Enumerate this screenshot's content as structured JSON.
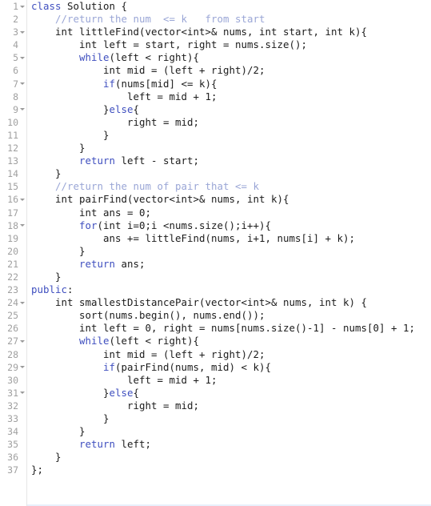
{
  "editor": {
    "language": "cpp",
    "background_color": "#ffffff",
    "gutter_color": "#ffffff",
    "line_number_color": "#a0a0a0",
    "keyword_color": "#3f4fbf",
    "comment_color": "#9aa6d6",
    "text_color": "#1b1b1b",
    "divider_color": "#e6e6e6",
    "total_lines": 37
  },
  "lines": [
    {
      "number": "1",
      "foldable": true,
      "tokens": [
        {
          "t": "kw",
          "s": "class"
        },
        {
          "t": "plain",
          "s": " Solution {"
        }
      ]
    },
    {
      "number": "2",
      "foldable": false,
      "tokens": [
        {
          "t": "plain",
          "s": "    "
        },
        {
          "t": "cmt",
          "s": "//return the num  <= k   from start"
        }
      ]
    },
    {
      "number": "3",
      "foldable": true,
      "tokens": [
        {
          "t": "plain",
          "s": "    "
        },
        {
          "t": "type",
          "s": "int"
        },
        {
          "t": "plain",
          "s": " littleFind("
        },
        {
          "t": "type",
          "s": "vector"
        },
        {
          "t": "punct",
          "s": "<"
        },
        {
          "t": "type",
          "s": "int"
        },
        {
          "t": "punct",
          "s": ">&"
        },
        {
          "t": "plain",
          "s": " nums, "
        },
        {
          "t": "type",
          "s": "int"
        },
        {
          "t": "plain",
          "s": " start, "
        },
        {
          "t": "type",
          "s": "int"
        },
        {
          "t": "plain",
          "s": " k){"
        }
      ]
    },
    {
      "number": "4",
      "foldable": false,
      "tokens": [
        {
          "t": "plain",
          "s": "        "
        },
        {
          "t": "type",
          "s": "int"
        },
        {
          "t": "plain",
          "s": " left = start, right = nums.size();"
        }
      ]
    },
    {
      "number": "5",
      "foldable": true,
      "tokens": [
        {
          "t": "plain",
          "s": "        "
        },
        {
          "t": "kw",
          "s": "while"
        },
        {
          "t": "plain",
          "s": "(left < right){"
        }
      ]
    },
    {
      "number": "6",
      "foldable": false,
      "tokens": [
        {
          "t": "plain",
          "s": "            "
        },
        {
          "t": "type",
          "s": "int"
        },
        {
          "t": "plain",
          "s": " mid = (left + right)/"
        },
        {
          "t": "num",
          "s": "2"
        },
        {
          "t": "plain",
          "s": ";"
        }
      ]
    },
    {
      "number": "7",
      "foldable": true,
      "tokens": [
        {
          "t": "plain",
          "s": "            "
        },
        {
          "t": "kw",
          "s": "if"
        },
        {
          "t": "plain",
          "s": "(nums[mid] <= k){"
        }
      ]
    },
    {
      "number": "8",
      "foldable": false,
      "tokens": [
        {
          "t": "plain",
          "s": "                left = mid + "
        },
        {
          "t": "num",
          "s": "1"
        },
        {
          "t": "plain",
          "s": ";"
        }
      ]
    },
    {
      "number": "9",
      "foldable": true,
      "tokens": [
        {
          "t": "plain",
          "s": "            }"
        },
        {
          "t": "kw",
          "s": "else"
        },
        {
          "t": "plain",
          "s": "{"
        }
      ]
    },
    {
      "number": "10",
      "foldable": false,
      "tokens": [
        {
          "t": "plain",
          "s": "                right = mid;"
        }
      ]
    },
    {
      "number": "11",
      "foldable": false,
      "tokens": [
        {
          "t": "plain",
          "s": "            }"
        }
      ]
    },
    {
      "number": "12",
      "foldable": false,
      "tokens": [
        {
          "t": "plain",
          "s": "        }"
        }
      ]
    },
    {
      "number": "13",
      "foldable": false,
      "tokens": [
        {
          "t": "plain",
          "s": "        "
        },
        {
          "t": "kw",
          "s": "return"
        },
        {
          "t": "plain",
          "s": " left - start;"
        }
      ]
    },
    {
      "number": "14",
      "foldable": false,
      "tokens": [
        {
          "t": "plain",
          "s": "    }"
        }
      ]
    },
    {
      "number": "15",
      "foldable": false,
      "tokens": [
        {
          "t": "plain",
          "s": "    "
        },
        {
          "t": "cmt",
          "s": "//return the num of pair that <= k"
        }
      ]
    },
    {
      "number": "16",
      "foldable": true,
      "tokens": [
        {
          "t": "plain",
          "s": "    "
        },
        {
          "t": "type",
          "s": "int"
        },
        {
          "t": "plain",
          "s": " pairFind("
        },
        {
          "t": "type",
          "s": "vector"
        },
        {
          "t": "punct",
          "s": "<"
        },
        {
          "t": "type",
          "s": "int"
        },
        {
          "t": "punct",
          "s": ">&"
        },
        {
          "t": "plain",
          "s": " nums, "
        },
        {
          "t": "type",
          "s": "int"
        },
        {
          "t": "plain",
          "s": " k){"
        }
      ]
    },
    {
      "number": "17",
      "foldable": false,
      "tokens": [
        {
          "t": "plain",
          "s": "        "
        },
        {
          "t": "type",
          "s": "int"
        },
        {
          "t": "plain",
          "s": " ans = "
        },
        {
          "t": "num",
          "s": "0"
        },
        {
          "t": "plain",
          "s": ";"
        }
      ]
    },
    {
      "number": "18",
      "foldable": true,
      "tokens": [
        {
          "t": "plain",
          "s": "        "
        },
        {
          "t": "kw",
          "s": "for"
        },
        {
          "t": "plain",
          "s": "("
        },
        {
          "t": "type",
          "s": "int"
        },
        {
          "t": "plain",
          "s": " i="
        },
        {
          "t": "num",
          "s": "0"
        },
        {
          "t": "plain",
          "s": ";i <nums.size();i++){"
        }
      ]
    },
    {
      "number": "19",
      "foldable": false,
      "tokens": [
        {
          "t": "plain",
          "s": "            ans += littleFind(nums, i+"
        },
        {
          "t": "num",
          "s": "1"
        },
        {
          "t": "plain",
          "s": ", nums[i] + k);"
        }
      ]
    },
    {
      "number": "20",
      "foldable": false,
      "tokens": [
        {
          "t": "plain",
          "s": "        }"
        }
      ]
    },
    {
      "number": "21",
      "foldable": false,
      "tokens": [
        {
          "t": "plain",
          "s": "        "
        },
        {
          "t": "kw",
          "s": "return"
        },
        {
          "t": "plain",
          "s": " ans;"
        }
      ]
    },
    {
      "number": "22",
      "foldable": false,
      "tokens": [
        {
          "t": "plain",
          "s": "    }"
        }
      ]
    },
    {
      "number": "23",
      "foldable": false,
      "tokens": [
        {
          "t": "kw",
          "s": "public"
        },
        {
          "t": "plain",
          "s": ":"
        }
      ]
    },
    {
      "number": "24",
      "foldable": true,
      "tokens": [
        {
          "t": "plain",
          "s": "    "
        },
        {
          "t": "type",
          "s": "int"
        },
        {
          "t": "plain",
          "s": " smallestDistancePair("
        },
        {
          "t": "type",
          "s": "vector"
        },
        {
          "t": "punct",
          "s": "<"
        },
        {
          "t": "type",
          "s": "int"
        },
        {
          "t": "punct",
          "s": ">&"
        },
        {
          "t": "plain",
          "s": " nums, "
        },
        {
          "t": "type",
          "s": "int"
        },
        {
          "t": "plain",
          "s": " k) {"
        }
      ]
    },
    {
      "number": "25",
      "foldable": false,
      "tokens": [
        {
          "t": "plain",
          "s": "        sort(nums.begin(), nums.end());"
        }
      ]
    },
    {
      "number": "26",
      "foldable": false,
      "tokens": [
        {
          "t": "plain",
          "s": "        "
        },
        {
          "t": "type",
          "s": "int"
        },
        {
          "t": "plain",
          "s": " left = "
        },
        {
          "t": "num",
          "s": "0"
        },
        {
          "t": "plain",
          "s": ", right = nums[nums.size()-"
        },
        {
          "t": "num",
          "s": "1"
        },
        {
          "t": "plain",
          "s": "] - nums["
        },
        {
          "t": "num",
          "s": "0"
        },
        {
          "t": "plain",
          "s": "] + "
        },
        {
          "t": "num",
          "s": "1"
        },
        {
          "t": "plain",
          "s": ";"
        }
      ]
    },
    {
      "number": "27",
      "foldable": true,
      "tokens": [
        {
          "t": "plain",
          "s": "        "
        },
        {
          "t": "kw",
          "s": "while"
        },
        {
          "t": "plain",
          "s": "(left < right){"
        }
      ]
    },
    {
      "number": "28",
      "foldable": false,
      "tokens": [
        {
          "t": "plain",
          "s": "            "
        },
        {
          "t": "type",
          "s": "int"
        },
        {
          "t": "plain",
          "s": " mid = (left + right)/"
        },
        {
          "t": "num",
          "s": "2"
        },
        {
          "t": "plain",
          "s": ";"
        }
      ]
    },
    {
      "number": "29",
      "foldable": true,
      "tokens": [
        {
          "t": "plain",
          "s": "            "
        },
        {
          "t": "kw",
          "s": "if"
        },
        {
          "t": "plain",
          "s": "(pairFind(nums, mid) < k){"
        }
      ]
    },
    {
      "number": "30",
      "foldable": false,
      "tokens": [
        {
          "t": "plain",
          "s": "                left = mid + "
        },
        {
          "t": "num",
          "s": "1"
        },
        {
          "t": "plain",
          "s": ";"
        }
      ]
    },
    {
      "number": "31",
      "foldable": true,
      "tokens": [
        {
          "t": "plain",
          "s": "            }"
        },
        {
          "t": "kw",
          "s": "else"
        },
        {
          "t": "plain",
          "s": "{"
        }
      ]
    },
    {
      "number": "32",
      "foldable": false,
      "tokens": [
        {
          "t": "plain",
          "s": "                right = mid;"
        }
      ]
    },
    {
      "number": "33",
      "foldable": false,
      "tokens": [
        {
          "t": "plain",
          "s": "            }"
        }
      ]
    },
    {
      "number": "34",
      "foldable": false,
      "tokens": [
        {
          "t": "plain",
          "s": "        }"
        }
      ]
    },
    {
      "number": "35",
      "foldable": false,
      "tokens": [
        {
          "t": "plain",
          "s": "        "
        },
        {
          "t": "kw",
          "s": "return"
        },
        {
          "t": "plain",
          "s": " left;"
        }
      ]
    },
    {
      "number": "36",
      "foldable": false,
      "tokens": [
        {
          "t": "plain",
          "s": "    }"
        }
      ]
    },
    {
      "number": "37",
      "foldable": false,
      "tokens": [
        {
          "t": "plain",
          "s": "};"
        }
      ]
    }
  ]
}
